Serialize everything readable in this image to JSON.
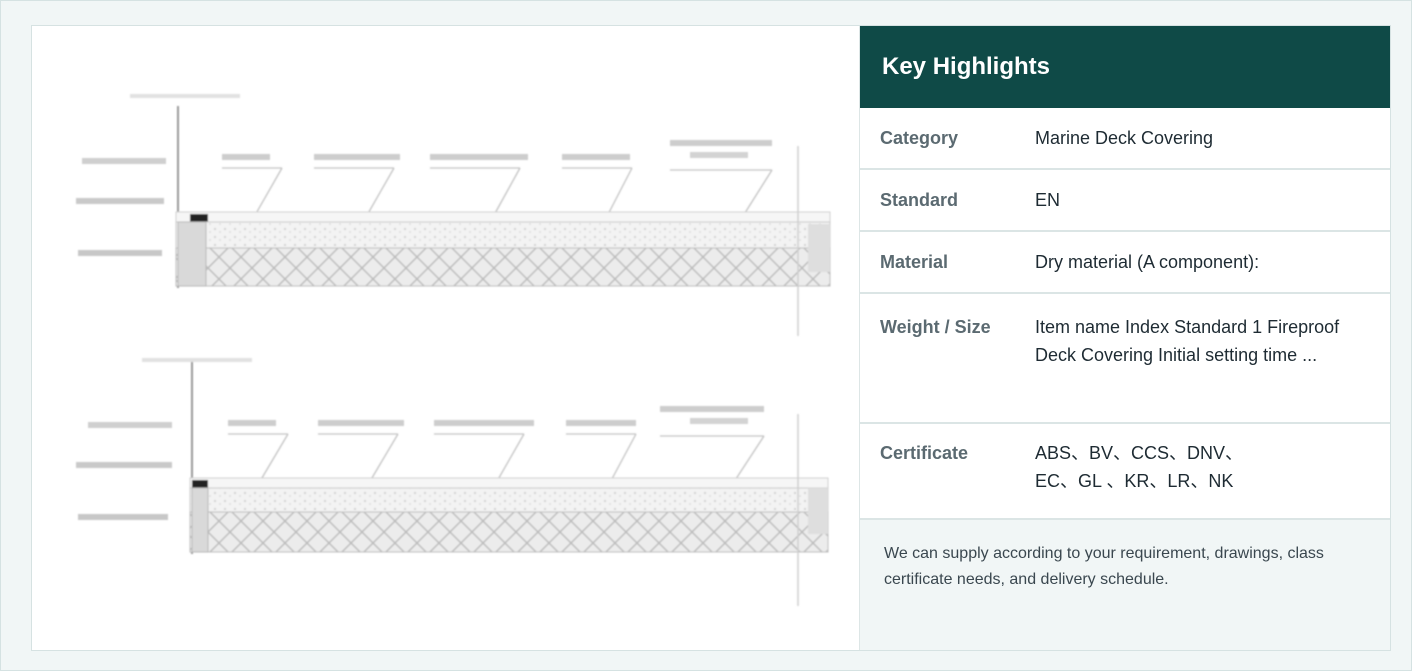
{
  "highlights": {
    "title": "Key Highlights",
    "rows": [
      {
        "key": "Category",
        "value": "Marine Deck Covering"
      },
      {
        "key": "Standard",
        "value": "EN"
      },
      {
        "key": "Material",
        "value": "Dry material (A component):"
      },
      {
        "key": "Weight / Size",
        "value": "Item name Index Standard 1 Fireproof Deck Covering Initial setting time ..."
      },
      {
        "key": "Certificate",
        "value_line1": "ABS、BV、CCS、DNV、",
        "value_line2": "EC、GL 、KR、LR、NK"
      }
    ],
    "note": "We can supply according to your requirement, drawings, class certificate needs, and delivery schedule."
  },
  "colors": {
    "header_bg": "#0f4a47",
    "page_bg": "#f1f6f6",
    "border": "#dbe5e5"
  }
}
